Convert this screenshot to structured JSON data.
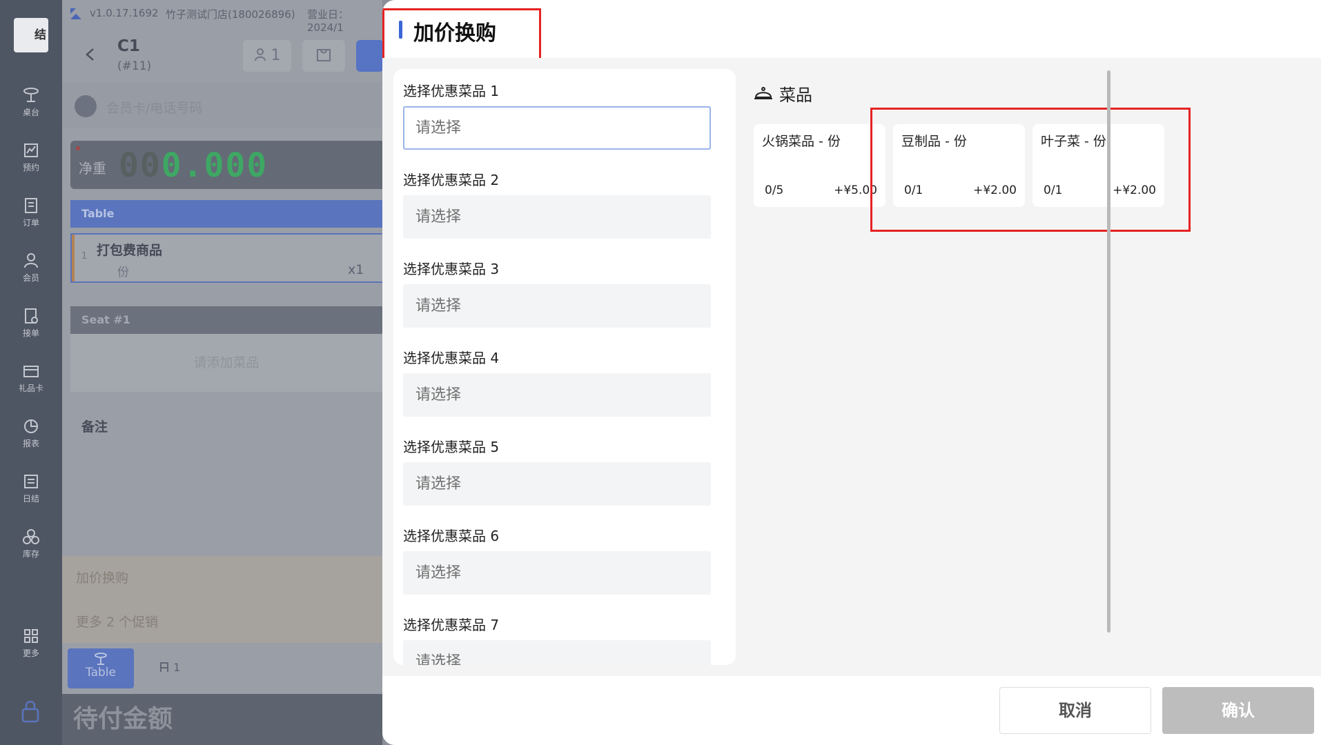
{
  "nav": {
    "brand_text": "结",
    "items": [
      {
        "label": "桌台",
        "icon": "table-icon"
      },
      {
        "label": "预约",
        "icon": "reservation-icon"
      },
      {
        "label": "订单",
        "icon": "order-icon"
      },
      {
        "label": "会员",
        "icon": "member-icon"
      },
      {
        "label": "接单",
        "icon": "accept-order-icon"
      },
      {
        "label": "礼品卡",
        "icon": "gift-card-icon"
      },
      {
        "label": "报表",
        "icon": "report-icon"
      },
      {
        "label": "日结",
        "icon": "daily-close-icon"
      },
      {
        "label": "库存",
        "icon": "inventory-icon"
      },
      {
        "label": "更多",
        "icon": "more-grid-icon"
      }
    ]
  },
  "pos": {
    "version": "v1.0.17.1692",
    "store": "竹子测试门店(180026896)",
    "business_day": "营业日：2024/1",
    "table_name": "C1",
    "table_sub": "(#11)",
    "guest_count": "1",
    "member_placeholder": "会员卡/电话号码",
    "scale_label": "净重",
    "scale_off_digits": "00",
    "scale_value": "0.000",
    "table_section": "Table",
    "line_item": {
      "index": "1",
      "name": "打包费商品",
      "unit": "份",
      "qty": "x1"
    },
    "seat_section": "Seat #1",
    "empty_hint": "请添加菜品",
    "remark_label": "备注",
    "promo_1": "加价换购",
    "promo_2": "更多 2 个促销",
    "tab_table": "Table",
    "seat_count": "1",
    "due_label": "待付金额"
  },
  "modal": {
    "title": "加价换购",
    "slots": [
      {
        "label": "选择优惠菜品 1",
        "placeholder": "请选择"
      },
      {
        "label": "选择优惠菜品 2",
        "placeholder": "请选择"
      },
      {
        "label": "选择优惠菜品 3",
        "placeholder": "请选择"
      },
      {
        "label": "选择优惠菜品 4",
        "placeholder": "请选择"
      },
      {
        "label": "选择优惠菜品 5",
        "placeholder": "请选择"
      },
      {
        "label": "选择优惠菜品 6",
        "placeholder": "请选择"
      },
      {
        "label": "选择优惠菜品 7",
        "placeholder": "请选择"
      }
    ],
    "dish_section_title": "菜品",
    "dishes": [
      {
        "name": "火锅菜品 - 份",
        "count": "0/5",
        "price": "+¥5.00"
      },
      {
        "name": "豆制品 - 份",
        "count": "0/1",
        "price": "+¥2.00"
      },
      {
        "name": "叶子菜 - 份",
        "count": "0/1",
        "price": "+¥2.00"
      }
    ],
    "cancel_label": "取消",
    "confirm_label": "确认"
  },
  "colors": {
    "accent": "#3b66d6",
    "highlight": "#e52222",
    "confirm_disabled": "#bdbdbd"
  }
}
